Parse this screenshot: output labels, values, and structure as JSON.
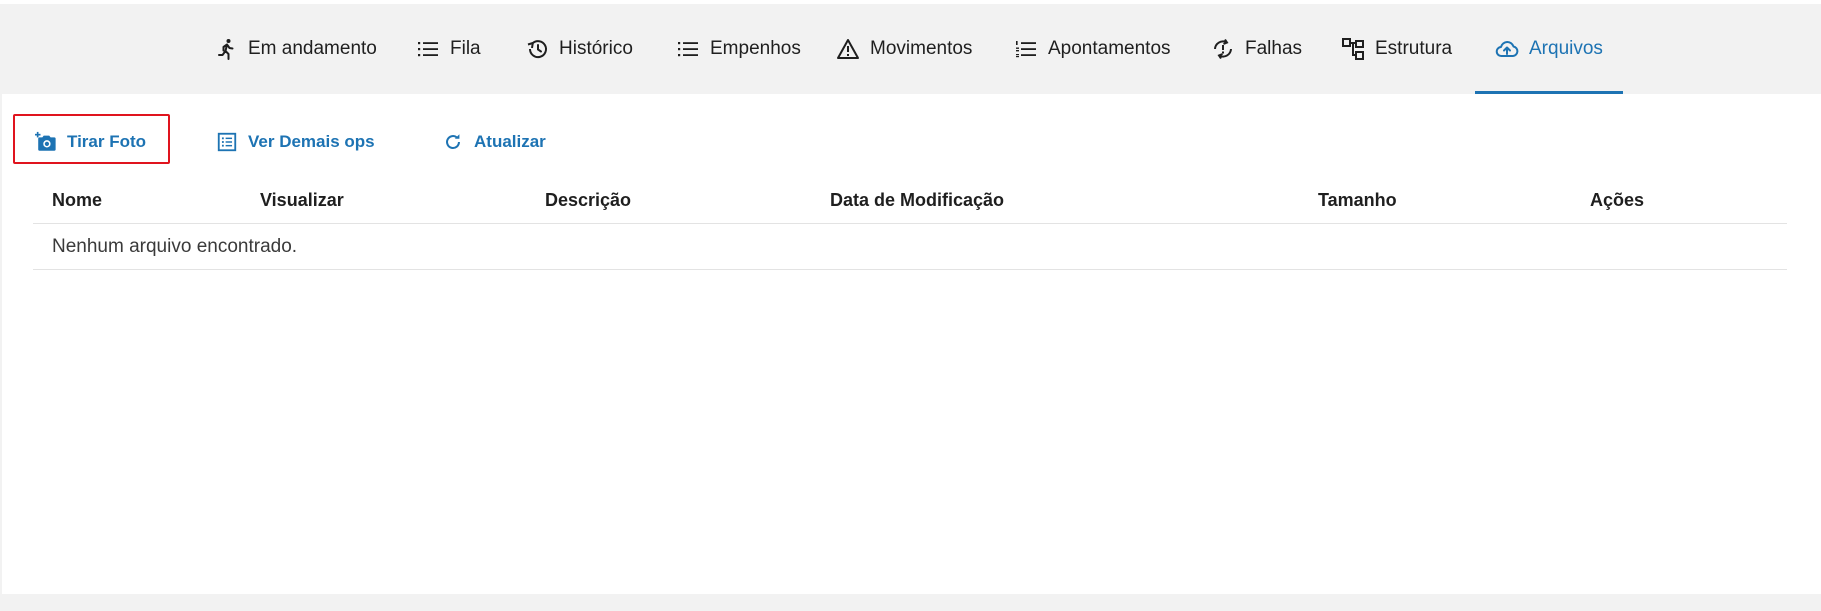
{
  "tabs": [
    {
      "label": "Em andamento",
      "icon": "running-person-icon"
    },
    {
      "label": "Fila",
      "icon": "list-icon"
    },
    {
      "label": "Histórico",
      "icon": "history-icon"
    },
    {
      "label": "Empenhos",
      "icon": "list-icon"
    },
    {
      "label": "Movimentos",
      "icon": "warning-triangle-icon"
    },
    {
      "label": "Apontamentos",
      "icon": "numbered-list-icon"
    },
    {
      "label": "Falhas",
      "icon": "sync-problem-icon"
    },
    {
      "label": "Estrutura",
      "icon": "account-tree-icon"
    },
    {
      "label": "Arquivos",
      "icon": "cloud-upload-icon"
    }
  ],
  "active_tab": "Arquivos",
  "actions": {
    "take_photo": "Tirar Foto",
    "view_other_ops": "Ver Demais ops",
    "refresh": "Atualizar"
  },
  "table": {
    "columns": [
      "Nome",
      "Visualizar",
      "Descrição",
      "Data de Modificação",
      "Tamanho",
      "Ações"
    ],
    "empty_message": "Nenhum arquivo encontrado."
  },
  "colors": {
    "accent": "#1d73b3",
    "highlight_border": "#e0141e",
    "tabbar_background": "#f2f2f2"
  }
}
